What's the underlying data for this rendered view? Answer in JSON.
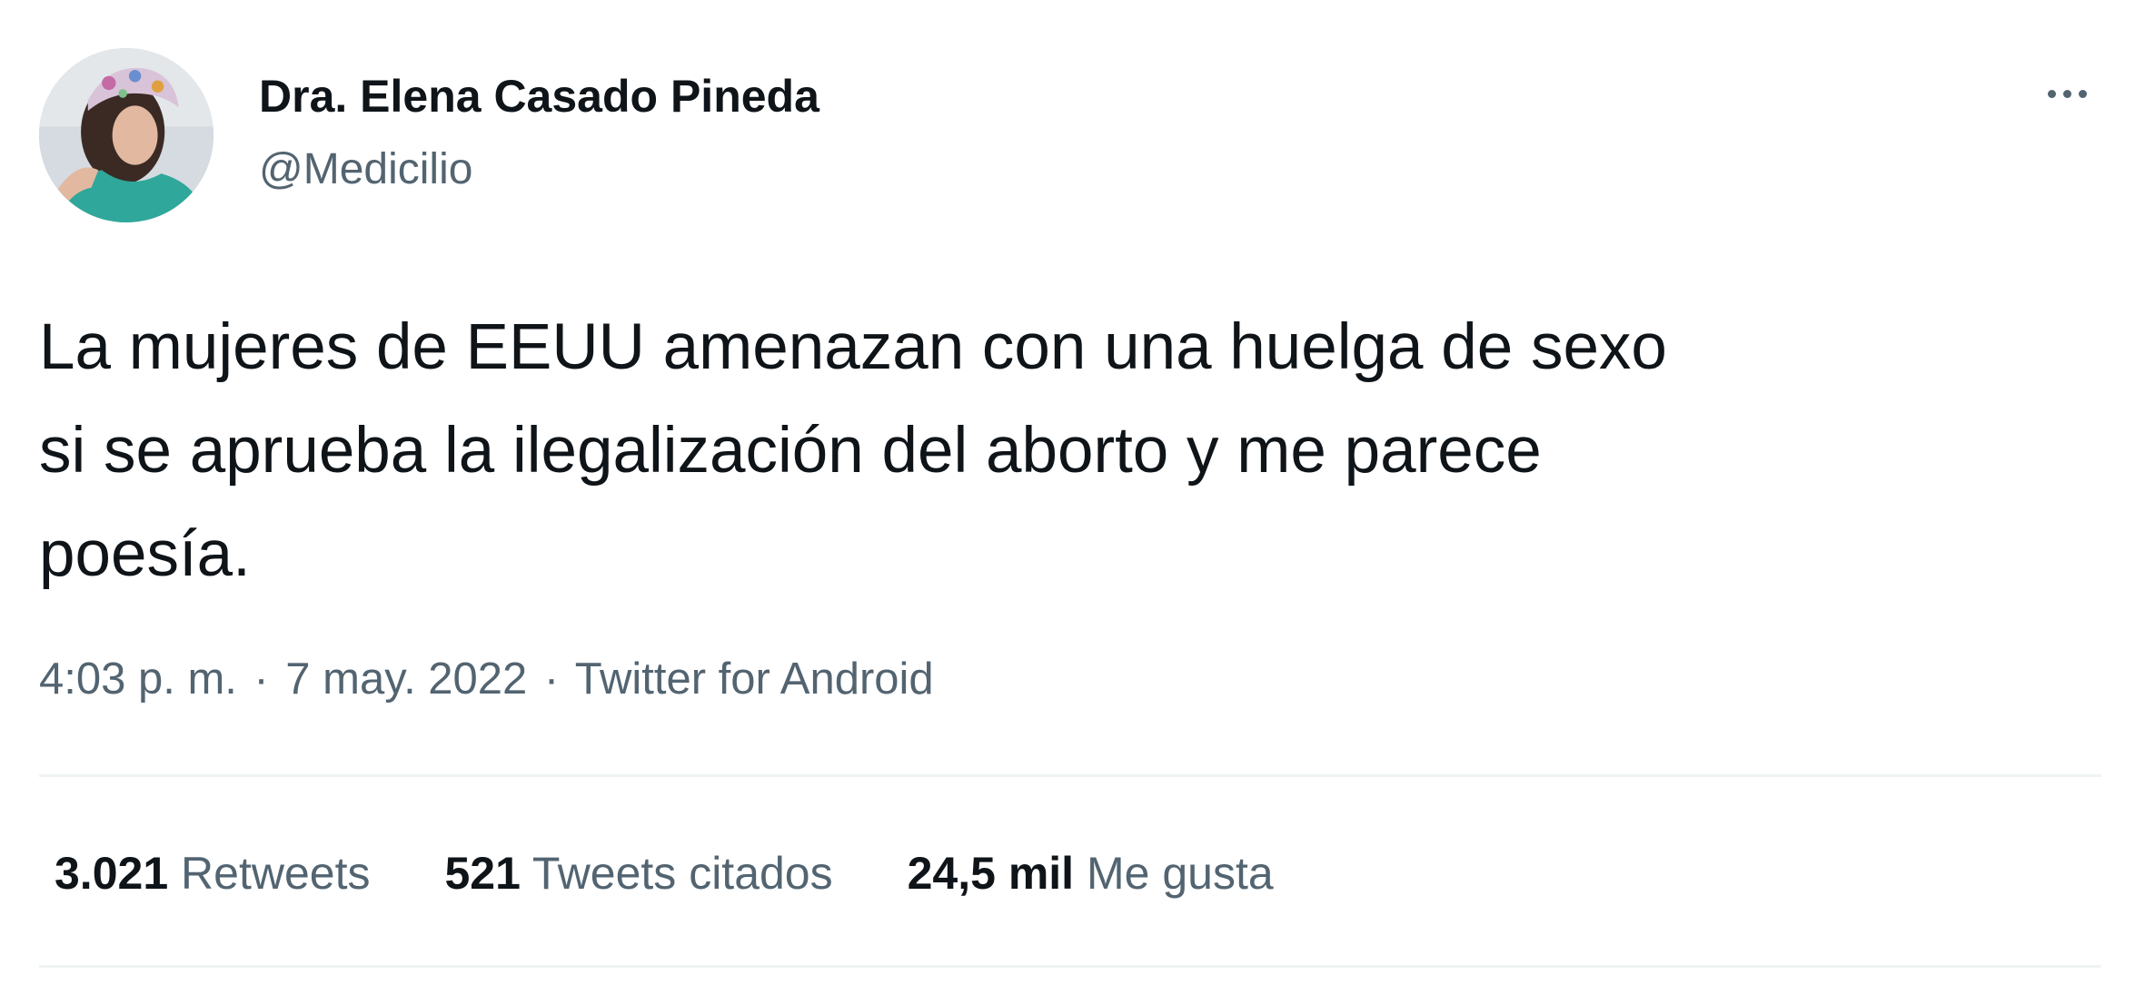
{
  "user": {
    "display_name": "Dra. Elena Casado Pineda",
    "handle": "@Medicilio"
  },
  "tweet": {
    "text_lines": [
      "La mujeres de EEUU amenazan con una huelga de sexo",
      "si se aprueba la ilegalización del aborto y me parece",
      "poesía."
    ],
    "time": "4:03 p. m.",
    "date": "7 may. 2022",
    "source": "Twitter for Android",
    "separator": "·"
  },
  "stats": {
    "retweets_count": "3.021",
    "retweets_label": "Retweets",
    "quotes_count": "521",
    "quotes_label": "Tweets citados",
    "likes_count": "24,5 mil",
    "likes_label": "Me gusta"
  },
  "icons": {
    "more": "more-horizontal-icon"
  },
  "colors": {
    "text_primary": "#0f1419",
    "text_secondary": "#536471",
    "divider": "#eff3f4",
    "background": "#ffffff"
  }
}
